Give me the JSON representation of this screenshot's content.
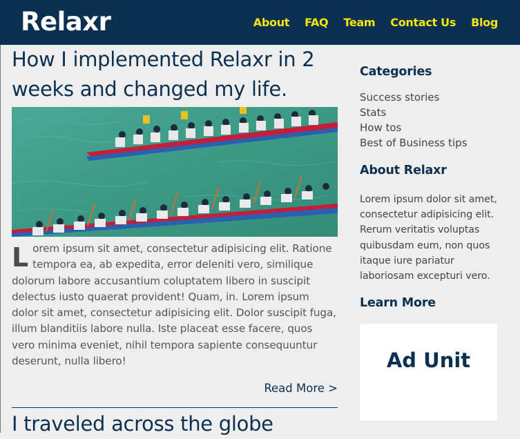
{
  "header": {
    "logo": "Relaxr",
    "nav": [
      "About",
      "FAQ",
      "Team",
      "Contact Us",
      "Blog"
    ]
  },
  "post1": {
    "title": "How I implemented Relaxr in 2 weeks and changed my life.",
    "dropcap": "L",
    "body": "orem ipsum sit amet, consectetur adipisicing elit. Ratione tempora ea, ab expedita, error deleniti vero, similique dolorum labore accusantium coluptatem libero in suscipit delectus iusto quaerat provident! Quam, in. Lorem ipsum dolor sit amet, consectetur adipisicing elit. Dolor suscipit fuga, illum blanditiis labore nulla. Iste placeat esse facere, quos vero minima eveniet, nihil tempora sapiente consequuntur deserunt, nulla libero!",
    "read_more": "Read More >"
  },
  "post2": {
    "title": "I traveled across the globe"
  },
  "sidebar": {
    "categories_heading": "Categories",
    "categories": [
      "Success stories",
      "Stats",
      "How tos",
      "Best of Business tips"
    ],
    "about_heading": "About Relaxr",
    "about_text": "Lorem ipsum dolor sit amet, consectetur adipisicing elit. Rerum veritatis voluptas quibusdam eum, non quos itaque iure pariatur laboriosam excepturi vero.",
    "learn_heading": "Learn More",
    "ad_label": "Ad Unit"
  },
  "colors": {
    "header_bg": "#0b3050",
    "nav_link": "#f5e514",
    "water": "#3e9c88",
    "boat_red": "#c0203a",
    "boat_blue": "#2a4fa0"
  },
  "hero_image": "dragon-boat-race-photo"
}
